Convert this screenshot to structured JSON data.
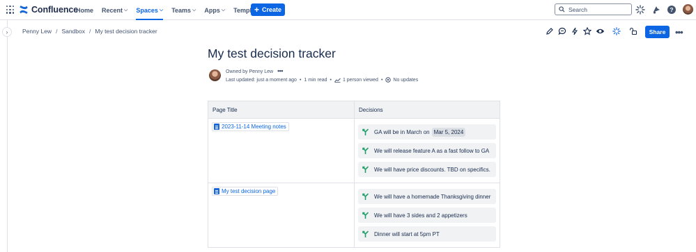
{
  "topnav": {
    "product": "Confluence",
    "items": [
      {
        "label": "Home",
        "chevron": false
      },
      {
        "label": "Recent",
        "chevron": true
      },
      {
        "label": "Spaces",
        "chevron": true,
        "active": true
      },
      {
        "label": "Teams",
        "chevron": true
      },
      {
        "label": "Apps",
        "chevron": true
      },
      {
        "label": "Templates",
        "chevron": false
      }
    ],
    "create_label": "Create",
    "search_placeholder": "Search",
    "icons": [
      "app-switcher-icon",
      "confluence-logo-icon",
      "search-icon",
      "rovo-icon",
      "notifications-icon",
      "help-icon",
      "avatar"
    ]
  },
  "breadcrumb": {
    "items": [
      "Penny Lew",
      "Sandbox",
      "My test decision tracker"
    ],
    "separator": "/"
  },
  "pagetools": {
    "icons": [
      "edit-icon",
      "comment-icon",
      "lightning-icon",
      "star-icon",
      "watch-icon",
      "ai-icon",
      "restrictions-icon"
    ],
    "share_label": "Share",
    "more_label": "•••"
  },
  "page": {
    "title": "My test decision tracker",
    "owner": "Owned by Penny Lew",
    "owner_more": "•••",
    "last_updated": "Last updated: just a moment ago",
    "read_time": "1 min read",
    "views": "1 person viewed",
    "updates": "No updates"
  },
  "table": {
    "headers": [
      "Page Title",
      "Decisions"
    ],
    "rows": [
      {
        "page": "2023-11-14 Meeting notes",
        "decisions": [
          {
            "text": "GA will be in March on",
            "date": "Mar 5, 2024"
          },
          {
            "text": "We will release feature A as a fast follow to GA"
          },
          {
            "text": "We will have price discounts. TBD on specifics."
          }
        ]
      },
      {
        "page": "My test decision page",
        "decisions": [
          {
            "text": "We will have a homemade Thanksgiving dinner"
          },
          {
            "text": "We will have 3 sides and 2 appetizers"
          },
          {
            "text": "Dinner will start at 5pm PT"
          }
        ]
      }
    ]
  },
  "colors": {
    "accent": "#0c66e4",
    "decision_icon": "#22a06b",
    "text": "#172b4d",
    "subtle_text": "#44546f",
    "border": "#dfe1e6",
    "header_bg": "#f1f2f4"
  }
}
